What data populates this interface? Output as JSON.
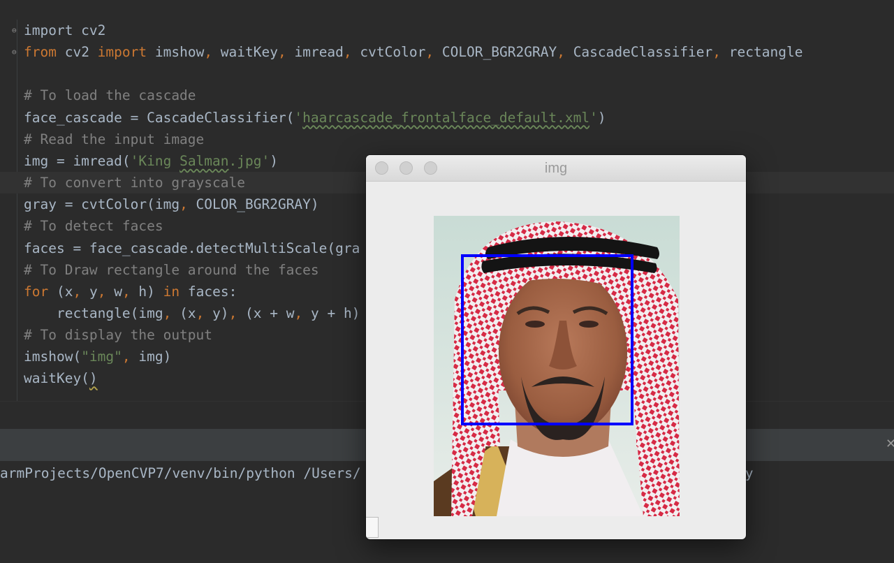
{
  "editor": {
    "lines": [
      [
        {
          "t": "import cv2",
          "c": ""
        }
      ],
      [
        {
          "t": "from",
          "c": "kw"
        },
        {
          "t": " cv2 ",
          "c": ""
        },
        {
          "t": "import",
          "c": "kw"
        },
        {
          "t": " imshow",
          "c": ""
        },
        {
          "t": ",",
          "c": "kw"
        },
        {
          "t": " waitKey",
          "c": ""
        },
        {
          "t": ",",
          "c": "kw"
        },
        {
          "t": " imread",
          "c": ""
        },
        {
          "t": ",",
          "c": "kw"
        },
        {
          "t": " cvtColor",
          "c": ""
        },
        {
          "t": ",",
          "c": "kw"
        },
        {
          "t": " COLOR_BGR2GRAY",
          "c": ""
        },
        {
          "t": ",",
          "c": "kw"
        },
        {
          "t": " CascadeClassifier",
          "c": ""
        },
        {
          "t": ",",
          "c": "kw"
        },
        {
          "t": " rectangle",
          "c": ""
        }
      ],
      [],
      [
        {
          "t": "# To load the cascade",
          "c": "cm"
        }
      ],
      [
        {
          "t": "face_cascade = CascadeClassifier(",
          "c": ""
        },
        {
          "t": "'",
          "c": "st"
        },
        {
          "t": "haarcascade_frontalface_default.xml",
          "c": "st sq"
        },
        {
          "t": "'",
          "c": "st"
        },
        {
          "t": ")",
          "c": ""
        }
      ],
      [
        {
          "t": "# Read the input image",
          "c": "cm"
        }
      ],
      [
        {
          "t": "img = imread(",
          "c": ""
        },
        {
          "t": "'King ",
          "c": "st"
        },
        {
          "t": "Salman",
          "c": "st sq"
        },
        {
          "t": ".jpg'",
          "c": "st"
        },
        {
          "t": ")",
          "c": ""
        }
      ],
      [
        {
          "t": "# To convert into grayscale",
          "c": "cm"
        }
      ],
      [
        {
          "t": "gray = cvtColor(img",
          "c": ""
        },
        {
          "t": ",",
          "c": "kw"
        },
        {
          "t": " COLOR_BGR2GRAY)",
          "c": ""
        }
      ],
      [
        {
          "t": "# To detect faces",
          "c": "cm"
        }
      ],
      [
        {
          "t": "faces = face_cascade.detectMultiScale(gra",
          "c": ""
        }
      ],
      [
        {
          "t": "# To Draw rectangle around the faces",
          "c": "cm"
        }
      ],
      [
        {
          "t": "for",
          "c": "kw"
        },
        {
          "t": " (x",
          "c": ""
        },
        {
          "t": ",",
          "c": "kw"
        },
        {
          "t": " y",
          "c": ""
        },
        {
          "t": ",",
          "c": "kw"
        },
        {
          "t": " w",
          "c": ""
        },
        {
          "t": ",",
          "c": "kw"
        },
        {
          "t": " h) ",
          "c": ""
        },
        {
          "t": "in",
          "c": "kw"
        },
        {
          "t": " faces:",
          "c": ""
        }
      ],
      [
        {
          "t": "    rectangle(img",
          "c": ""
        },
        {
          "t": ",",
          "c": "kw"
        },
        {
          "t": " (x",
          "c": ""
        },
        {
          "t": ",",
          "c": "kw"
        },
        {
          "t": " y)",
          "c": ""
        },
        {
          "t": ",",
          "c": "kw"
        },
        {
          "t": " (x + w",
          "c": ""
        },
        {
          "t": ",",
          "c": "kw"
        },
        {
          "t": " y + h)",
          "c": ""
        }
      ],
      [
        {
          "t": "# To display the output",
          "c": "cm"
        }
      ],
      [
        {
          "t": "imshow(",
          "c": ""
        },
        {
          "t": "\"img\"",
          "c": "st"
        },
        {
          "t": ",",
          "c": "kw"
        },
        {
          "t": " img)",
          "c": ""
        }
      ],
      [
        {
          "t": "waitKey(",
          "c": ""
        },
        {
          "t": ")",
          "c": "sqy"
        }
      ]
    ]
  },
  "run_console": {
    "left_text": "armProjects/OpenCVP7/venv/bin/python /Users/",
    "right_text": "py",
    "close_glyph": "✕"
  },
  "image_window": {
    "title": "img",
    "buttons": [
      "close-button",
      "minimize-button",
      "zoom-button"
    ]
  },
  "colors": {
    "editor_bg": "#2b2b2b",
    "keyword": "#cc7832",
    "comment": "#808080",
    "string": "#6a8759",
    "default_text": "#a9b7c6",
    "detection_box": "#0000ff"
  }
}
